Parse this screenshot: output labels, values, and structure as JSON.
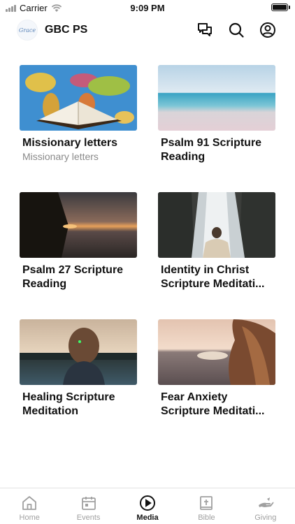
{
  "status_bar": {
    "carrier": "Carrier",
    "time": "9:09 PM"
  },
  "header": {
    "logo_text": "Grace",
    "title": "GBC PS",
    "icons": [
      "chat-icon",
      "search-icon",
      "profile-icon"
    ]
  },
  "media_items": [
    {
      "title": "Missionary letters",
      "subtitle": "Missionary letters",
      "thumbnail": "world-map-bible"
    },
    {
      "title": "Psalm 91 Scripture Reading",
      "subtitle": "",
      "thumbnail": "ocean-shore"
    },
    {
      "title": "Psalm 27 Scripture Reading",
      "subtitle": "",
      "thumbnail": "sunset-beach"
    },
    {
      "title": "Identity in Christ Scripture Meditati...",
      "subtitle": "",
      "thumbnail": "waterfall-person"
    },
    {
      "title": "Healing Scripture Meditation",
      "subtitle": "",
      "thumbnail": "woman-lake-sunset"
    },
    {
      "title": "Fear Anxiety Scripture Meditati...",
      "subtitle": "",
      "thumbnail": "woman-sea-sunset"
    }
  ],
  "tabs": [
    {
      "label": "Home",
      "icon": "home-icon",
      "active": false
    },
    {
      "label": "Events",
      "icon": "calendar-icon",
      "active": false
    },
    {
      "label": "Media",
      "icon": "play-icon",
      "active": true
    },
    {
      "label": "Bible",
      "icon": "bible-icon",
      "active": false
    },
    {
      "label": "Giving",
      "icon": "giving-hand-icon",
      "active": false
    }
  ],
  "colors": {
    "active_tab": "#111111",
    "inactive_tab": "#a0a0a0",
    "subtitle": "#8a8a8a"
  }
}
